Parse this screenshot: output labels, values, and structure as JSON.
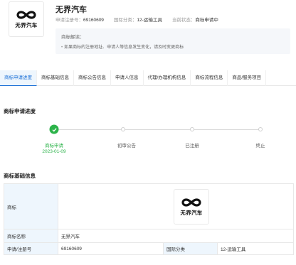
{
  "header": {
    "logo_text": "无界汽车",
    "title": "无界汽车",
    "reg_no_label": "申请注册号：",
    "reg_no": "69160609",
    "intl_class_label": "国际分类：",
    "intl_class": "12-运输工具",
    "status_label": "当前状态：",
    "status": "商标申请中"
  },
  "notice": {
    "title": "商标解读：",
    "text": "如果商标的注册地址、申请人等信息发生变化，请及时变更商标"
  },
  "tabs": [
    {
      "label": "商标申请进度",
      "active": true
    },
    {
      "label": "商标基础信息"
    },
    {
      "label": "商标公告信息"
    },
    {
      "label": "申请人信息"
    },
    {
      "label": "代理/办理机构信息"
    },
    {
      "label": "商标流程信息"
    },
    {
      "label": "商品/服务项目"
    }
  ],
  "progress": {
    "section_title": "商标申请进度",
    "steps": [
      {
        "label": "商标申请",
        "date": "2023-01-09",
        "done": true
      },
      {
        "label": "初审公告",
        "done": false
      },
      {
        "label": "已注册",
        "done": false
      },
      {
        "label": "终止",
        "done": false
      }
    ]
  },
  "basic_info": {
    "section_title": "商标基础信息",
    "logo_label": "商标",
    "logo_text": "无界汽车",
    "name_label": "商标名称",
    "name_value": "无界汽车",
    "reg_label": "申请/注册号",
    "reg_value": "69160609",
    "class_label": "国际分类",
    "class_value": "12-运输工具"
  },
  "colors": {
    "accent": "#1a6fd6",
    "success": "#2cb34a",
    "label_bg": "#eef6fd",
    "notice_bg": "#f5f7fa"
  }
}
